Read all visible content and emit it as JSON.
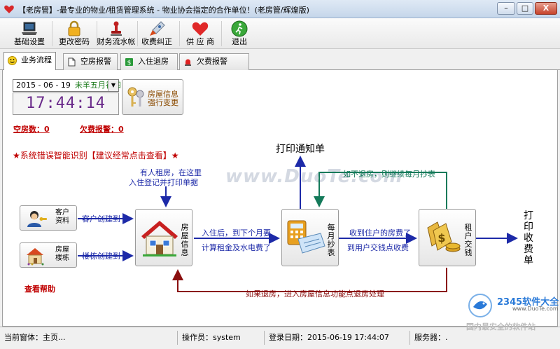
{
  "window": {
    "title": "【老房管】-最专业的物业/租赁管理系统 - 物业协会指定的合作单位！(老房管/辉煌版)",
    "min_label": "–",
    "max_label": "□",
    "close_label": "X"
  },
  "toolbar": {
    "items": [
      {
        "label": "基础设置"
      },
      {
        "label": "更改密码"
      },
      {
        "label": "财务流水帐"
      },
      {
        "label": "收费纠正"
      },
      {
        "label": "供 应 商"
      },
      {
        "label": "退出"
      }
    ]
  },
  "tabs": [
    {
      "label": "业务流程",
      "active": true
    },
    {
      "label": "空房报警"
    },
    {
      "label": "入住退房"
    },
    {
      "label": "欠费报警"
    }
  ],
  "header": {
    "date": "2015 - 06 - 19",
    "lunar": "未羊五月初四",
    "dropdown_glyph": "▼",
    "time": "17:44:14",
    "house_info_label_line1": "房屋信息",
    "house_info_label_line2": "强行变更"
  },
  "stats": {
    "vacant": "空房数：0",
    "arrears": "欠费报警：0"
  },
  "error_link": "★系统错误智能识别【建议经常点击查看】★",
  "help_link": "查看帮助",
  "nodes": {
    "customer": {
      "label": "客户资料"
    },
    "building": {
      "label": "房屋楼栋"
    },
    "house": {
      "label": "房屋信息"
    },
    "monthly": {
      "label": "每月抄表"
    },
    "rent": {
      "label": "租户交钱"
    }
  },
  "flow": {
    "customer_created": "客户创建到",
    "building_created": "楼栋创建到",
    "rental_note_1": "有人租房，在这里",
    "rental_note_2": "入住登记并打印单据",
    "checkin_1": "入住后，到下个月要",
    "checkin_2": "计算租金及水电费了",
    "receive_1": "收到住户的房费了",
    "receive_2": "到用户交钱点收费",
    "not_leaving": "如不退房，则继续每月抄表",
    "checkout": "如果退房，进入房屋信息功能点退房处理",
    "print_notice": "打印通知单",
    "print_receipt": "打印收费单"
  },
  "watermark": "www.DuoTe.com",
  "status": {
    "current_window": "当前窗体：主页...",
    "operator": "操作员：system",
    "login_date": "登录日期：2015-06-19 17:44:07",
    "server": "服务器：."
  },
  "brand": {
    "line1": "2345软件大全",
    "line2": "www.DuoTe.com",
    "line3": "国内最安全的软件站"
  },
  "colors": {
    "arrow_blue": "#1d2aa8",
    "arrow_green": "#147a5a",
    "arrow_red": "#8a0f0f",
    "alert_red": "#c00000",
    "clock_purple": "#6a2a8a"
  }
}
